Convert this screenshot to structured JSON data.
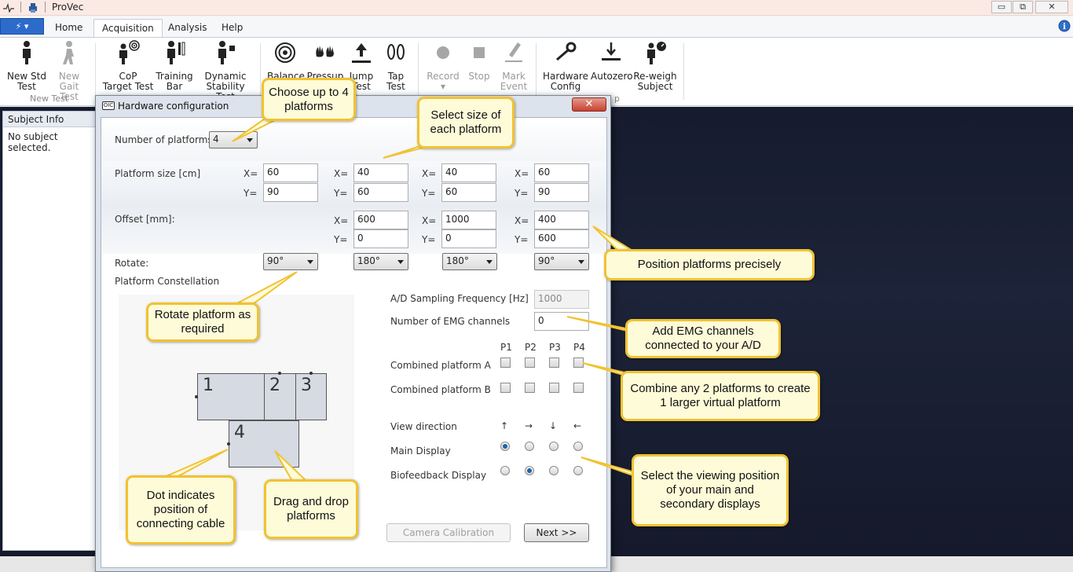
{
  "window": {
    "title": "ProVec",
    "minimize": "▭",
    "maximize": "⧉",
    "close": "✕"
  },
  "ribbon": {
    "app_menu_label": "⚡ ▾",
    "tabs": [
      "Home",
      "Acquisition",
      "Analysis",
      "Help"
    ],
    "active_tab": "Acquisition",
    "buttons": [
      {
        "label": "New Std Test",
        "line1": "New Std",
        "line2": "Test",
        "icon": "person-standing-icon",
        "disabled": false
      },
      {
        "label": "New Gait Test",
        "line1": "New",
        "line2": "Gait Test",
        "icon": "person-walking-icon",
        "disabled": true
      },
      {
        "label": "CoP Target Test",
        "line1": "CoP",
        "line2": "Target Test",
        "icon": "person-target-icon",
        "disabled": false
      },
      {
        "label": "Training Bar",
        "line1": "Training",
        "line2": "Bar",
        "icon": "person-bar-icon",
        "disabled": false
      },
      {
        "label": "Dynamic Stability Test",
        "line1": "Dynamic",
        "line2": "Stability Test",
        "icon": "person-dynamic-icon",
        "disabled": false
      },
      {
        "label": "Balance",
        "line1": "Balance",
        "line2": "",
        "icon": "target-icon",
        "disabled": false
      },
      {
        "label": "Pressup",
        "line1": "Pressup",
        "line2": "",
        "icon": "hands-icon",
        "disabled": false
      },
      {
        "label": "Jump Test",
        "line1": "Jump",
        "line2": "Test",
        "icon": "jump-icon",
        "disabled": false
      },
      {
        "label": "Tap Test",
        "line1": "Tap",
        "line2": "Test",
        "icon": "footprints-icon",
        "disabled": false
      },
      {
        "label": "Record",
        "line1": "Record",
        "line2": "▾",
        "icon": "record-icon",
        "disabled": true
      },
      {
        "label": "Stop",
        "line1": "Stop",
        "line2": "",
        "icon": "stop-icon",
        "disabled": true
      },
      {
        "label": "Mark Event",
        "line1": "Mark",
        "line2": "Event",
        "icon": "pen-icon",
        "disabled": true
      },
      {
        "label": "Hardware Config",
        "line1": "Hardware",
        "line2": "Config",
        "icon": "wrench-icon",
        "disabled": false
      },
      {
        "label": "Autozero",
        "line1": "Autozero",
        "line2": "",
        "icon": "autozero-icon",
        "disabled": false
      },
      {
        "label": "Re-weigh Subject",
        "line1": "Re-weigh",
        "line2": "Subject",
        "icon": "reweigh-icon",
        "disabled": false
      }
    ],
    "group_labels": {
      "new_test": "New Test",
      "setup_fragment": "p"
    }
  },
  "left_pane": {
    "header": "Subject Info",
    "empty_text": "No subject selected."
  },
  "dialog": {
    "title": "Hardware configuration",
    "icon_text": "OIC",
    "num_platforms_label": "Number of platforms:",
    "num_platforms_value": "4",
    "platform_size_label": "Platform size [cm]",
    "offset_label": "Offset [mm]:",
    "rotate_label": "Rotate:",
    "constellation_label": "Platform Constellation",
    "x_prefix": "X=",
    "y_prefix": "Y=",
    "platforms": [
      {
        "size_x": "60",
        "size_y": "90",
        "offset_x": "",
        "offset_y": "",
        "rotate": "90°"
      },
      {
        "size_x": "40",
        "size_y": "60",
        "offset_x": "600",
        "offset_y": "0",
        "rotate": "180°"
      },
      {
        "size_x": "40",
        "size_y": "60",
        "offset_x": "1000",
        "offset_y": "0",
        "rotate": "180°"
      },
      {
        "size_x": "60",
        "size_y": "90",
        "offset_x": "400",
        "offset_y": "600",
        "rotate": "90°"
      }
    ],
    "ad_freq_label": "A/D Sampling Frequency [Hz]",
    "ad_freq_value": "1000",
    "emg_label": "Number of EMG channels",
    "emg_value": "0",
    "p_headers": [
      "P1",
      "P2",
      "P3",
      "P4"
    ],
    "combined_a_label": "Combined platform A",
    "combined_b_label": "Combined platform B",
    "view_direction_label": "View direction",
    "arrows": [
      "↑",
      "→",
      "↓",
      "←"
    ],
    "main_display_label": "Main Display",
    "main_display_selected": 1,
    "biofeedback_label": "Biofeedback Display",
    "biofeedback_selected": 2,
    "constellation": [
      "1",
      "2",
      "3",
      "4"
    ],
    "camera_button": "Camera Calibration",
    "next_button": "Next >>"
  },
  "callouts": {
    "choose_platforms": "Choose up to 4 platforms",
    "select_size": "Select size of each platform",
    "position": "Position platforms precisely",
    "rotate": "Rotate platform as required",
    "emg": "Add EMG channels connected to your A/D",
    "combine": "Combine any 2 platforms to create 1 larger virtual platform",
    "viewing": "Select the viewing position of your main and secondary displays",
    "dot": "Dot indicates position of connecting cable",
    "drag": "Drag and drop platforms"
  }
}
